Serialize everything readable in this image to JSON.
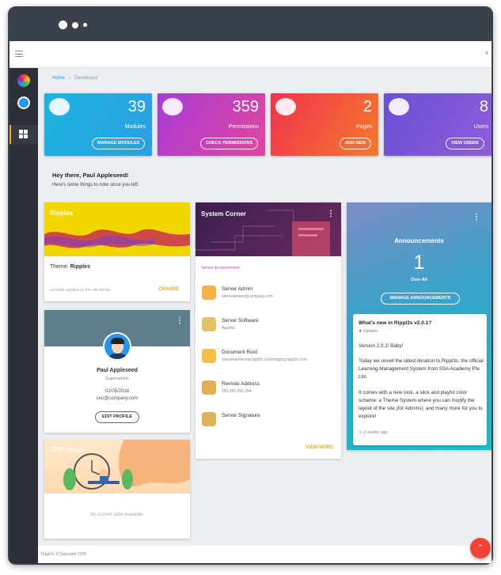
{
  "breadcrumb": {
    "home": "Home",
    "sep": "›",
    "current": "Dashboard"
  },
  "stats": [
    {
      "value": "39",
      "label": "Modules",
      "button": "MANAGE MODULES"
    },
    {
      "value": "359",
      "label": "Permissions",
      "button": "CHECK PERMISSIONS"
    },
    {
      "value": "2",
      "label": "Pages",
      "button": "ADD NEW"
    },
    {
      "value": "8",
      "label": "Users",
      "button": "VIEW USERS"
    }
  ],
  "greeting": {
    "title": "Hey there, Paul Appleseed!",
    "subtitle": "Here's some things to note since you left."
  },
  "ripples": {
    "title": "Ripples",
    "theme_label": "Theme:",
    "theme_value": "Ripples",
    "note": "currently applied as the site theme",
    "change": "CHANGE"
  },
  "profile": {
    "name": "Paul Appleseed",
    "role": "Superadmin",
    "date": "02/05/2018",
    "email": "ceo@company.com",
    "edit": "EDIT PROFILE"
  },
  "cpu": {
    "title": "CPU Usage",
    "empty": "No current data available."
  },
  "system": {
    "title": "System Corner",
    "section": "Server Environment",
    "items": [
      {
        "label": "Server Admin",
        "value": "administrator@company.com",
        "icon": "admin-icon"
      },
      {
        "label": "Server Software",
        "value": "Apache",
        "icon": "software-icon"
      },
      {
        "label": "Document Root",
        "value": "/var/www/vhosts/rippl3s.com/staging.rippl3s.com",
        "icon": "folder-icon"
      },
      {
        "label": "Remote Address",
        "value": "255.255.255.254",
        "icon": "remote-icon"
      },
      {
        "label": "Server Signature",
        "value": "",
        "icon": "server-icon"
      }
    ],
    "view_more": "VIEW MORE"
  },
  "announcements": {
    "title": "Announcements",
    "count": "1",
    "count_label": "Over All",
    "button": "MANAGE ANNOUNCEMENTS",
    "post": {
      "title": "What's new in Rippl3s v2.0.1?",
      "tag": "Updates",
      "p1": "Version 2.0.1! Baby!",
      "p2": "Today we unveil the latest iteration to Rippl3s, the official Learning Management System from SSA Academy Pte Ltd.",
      "p3": "It comes with a new look, a slick and playful color scheme; a Theme System where you can modify the layout of the site (for Admins); and many more for you to explore!",
      "time": "2 weeks ago"
    }
  },
  "footer": "Rippl3s © Copyright 2018",
  "colors": {
    "modules": "#1cb5e0",
    "permissions": "#c445c4",
    "pages": "#f0334e",
    "users": "#7b4fd6",
    "fab": "#f44336",
    "accent": "#f5a623"
  }
}
